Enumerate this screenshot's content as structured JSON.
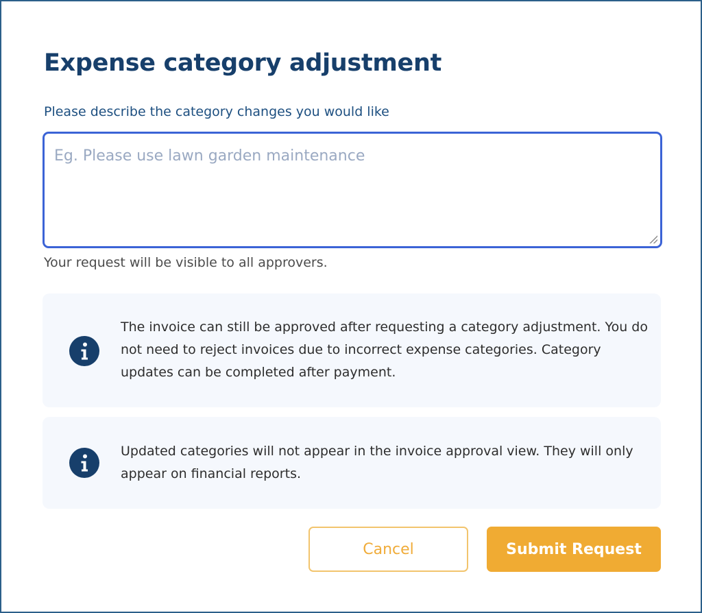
{
  "dialog": {
    "title": "Expense category adjustment",
    "field_label": "Please describe the category changes you would like",
    "request_input": {
      "value": "",
      "placeholder": "Eg. Please use lawn garden maintenance"
    },
    "helper_text": "Your request will be visible to all approvers.",
    "info_boxes": [
      {
        "icon": "info-icon",
        "text": "The invoice can still be approved after requesting a category adjustment. You do not need to reject invoices due to incorrect expense categories. Category updates can be completed after payment."
      },
      {
        "icon": "info-icon",
        "text": "Updated categories will not appear in the invoice approval view. They will only appear on financial reports."
      }
    ],
    "buttons": {
      "cancel_label": "Cancel",
      "submit_label": "Submit Request"
    }
  },
  "colors": {
    "title": "#173f6b",
    "label": "#1d4f80",
    "input_border_focus": "#3b63d6",
    "info_bg": "#f5f8fd",
    "info_icon": "#173f6b",
    "accent": "#f0ab33"
  }
}
